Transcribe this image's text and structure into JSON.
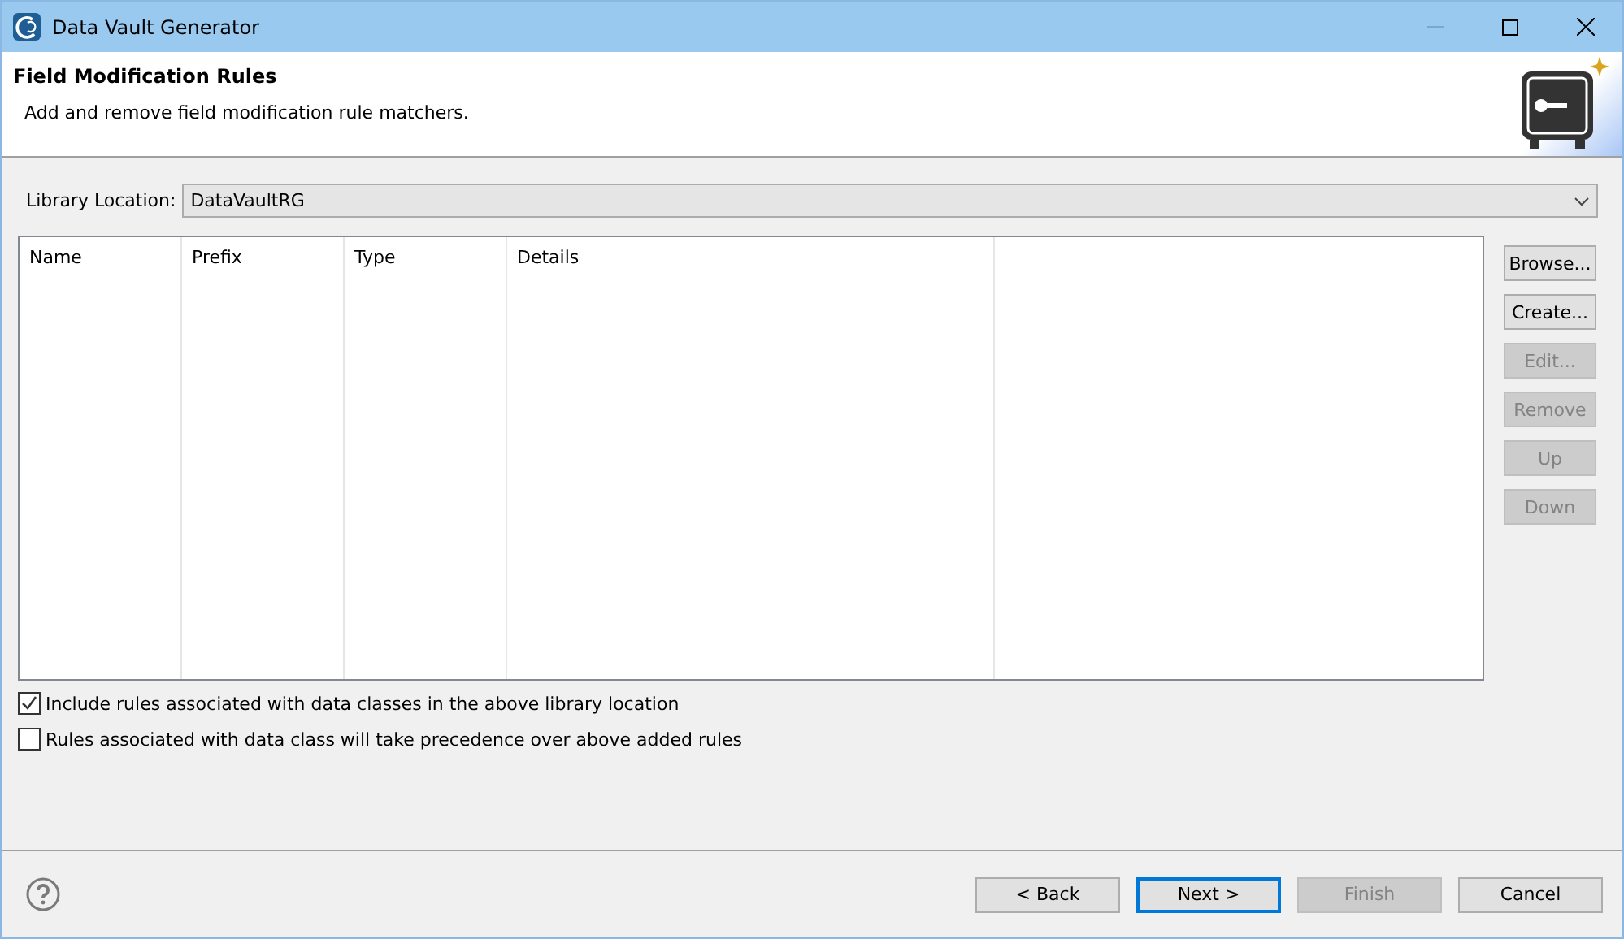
{
  "window": {
    "title": "Data Vault Generator"
  },
  "header": {
    "title": "Field Modification Rules",
    "description": "Add and remove field modification rule matchers."
  },
  "library_location": {
    "label": "Library Location:",
    "value": "DataVaultRG"
  },
  "table": {
    "columns": [
      "Name",
      "Prefix",
      "Type",
      "Details"
    ]
  },
  "side_buttons": [
    {
      "label": "Browse...",
      "disabled": false
    },
    {
      "label": "Create...",
      "disabled": false
    },
    {
      "label": "Edit...",
      "disabled": true
    },
    {
      "label": "Remove",
      "disabled": true
    },
    {
      "label": "Up",
      "disabled": true
    },
    {
      "label": "Down",
      "disabled": true
    }
  ],
  "options": [
    {
      "label": "Include rules associated with data classes in the above library location",
      "checked": true
    },
    {
      "label": "Rules associated with data class will take precedence over above added rules",
      "checked": false
    }
  ],
  "footer_buttons": [
    {
      "label": "< Back",
      "disabled": false,
      "default": false
    },
    {
      "label": "Next >",
      "disabled": false,
      "default": true
    },
    {
      "label": "Finish",
      "disabled": true,
      "default": false
    },
    {
      "label": "Cancel",
      "disabled": false,
      "default": false
    }
  ]
}
